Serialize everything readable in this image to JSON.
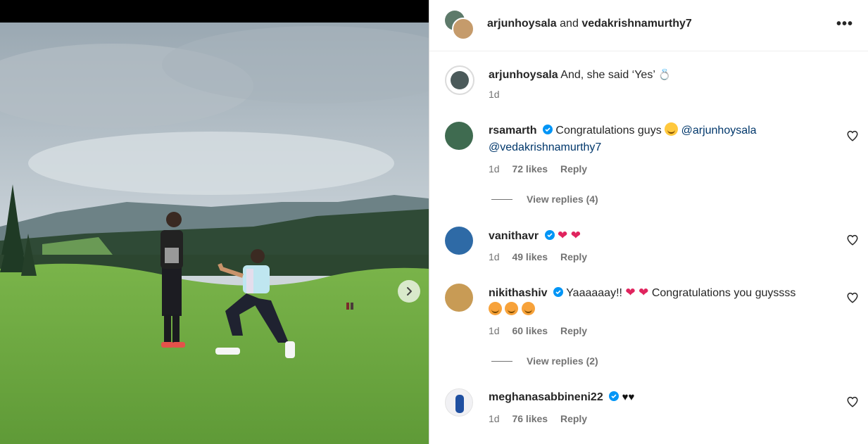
{
  "header": {
    "user1": "arjunhoysala",
    "joiner": "and",
    "user2": "vedakrishnamurthy7",
    "more_label": "•••"
  },
  "caption": {
    "username": "arjunhoysala",
    "text": "And, she said ‘Yes’",
    "time": "1d"
  },
  "comments": [
    {
      "username": "rsamarth",
      "text": "Congratulations guys",
      "mention1": "@arjunhoysala",
      "mention2": "@vedakrishnamurthy7",
      "time": "1d",
      "likes": "72 likes",
      "reply": "Reply",
      "view_replies": "View replies (4)"
    },
    {
      "username": "vanithavr",
      "text": "",
      "time": "1d",
      "likes": "49 likes",
      "reply": "Reply"
    },
    {
      "username": "nikithashiv",
      "text_a": "Yaaaaaay!!",
      "text_b": "Congratulations you guyssss",
      "time": "1d",
      "likes": "60 likes",
      "reply": "Reply",
      "view_replies": "View replies (2)"
    },
    {
      "username": "meghanasabbineni22",
      "text": "♥♥",
      "time": "1d",
      "likes": "76 likes",
      "reply": "Reply"
    }
  ],
  "icons": {
    "next": "chevron-right-icon",
    "more": "more-horizontal-icon",
    "like": "heart-outline-icon",
    "verified": "verified-badge-icon",
    "ring": "ring-emoji"
  },
  "colors": {
    "verified": "#0095f6",
    "mention": "#00376b",
    "meta": "#737373",
    "heart": "#e0245e"
  }
}
